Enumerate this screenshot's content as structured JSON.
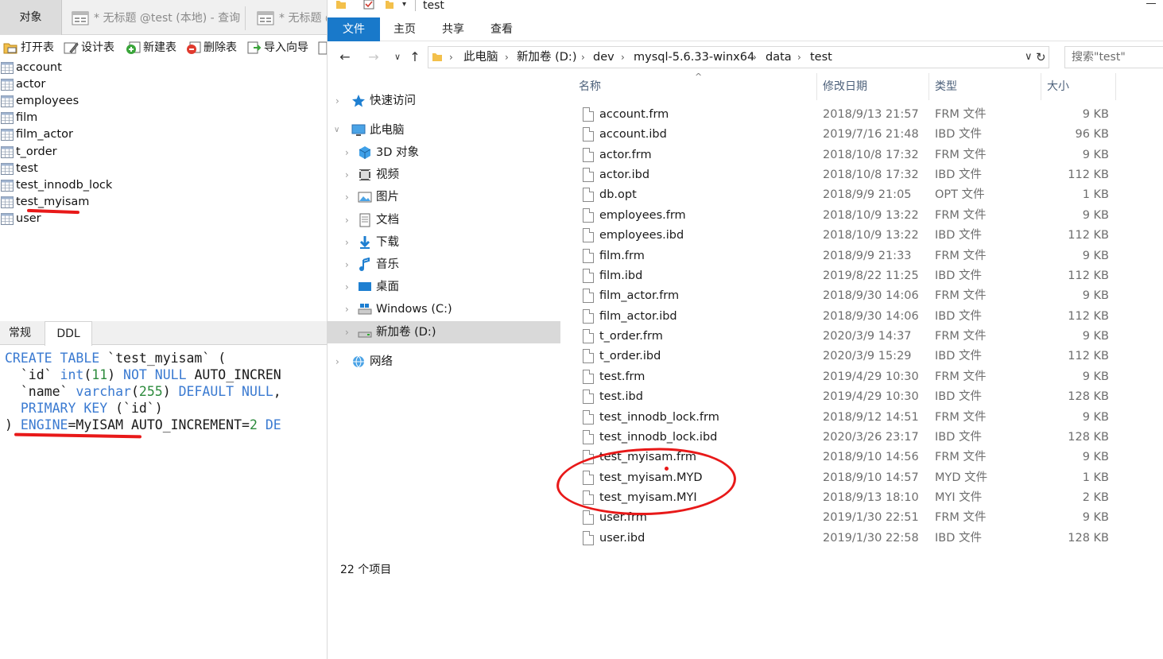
{
  "navicat": {
    "object_tab": "对象",
    "query_tabs": [
      {
        "label": "* 无标题 @test (本地) - 查询"
      },
      {
        "label": "* 无标题 @"
      }
    ],
    "toolbar": [
      {
        "label": "打开表",
        "icon": "open-table-icon"
      },
      {
        "label": "设计表",
        "icon": "design-table-icon"
      },
      {
        "label": "新建表",
        "icon": "new-table-icon"
      },
      {
        "label": "删除表",
        "icon": "delete-table-icon"
      },
      {
        "label": "导入向导",
        "icon": "import-wizard-icon"
      }
    ],
    "tables": [
      "account",
      "actor",
      "employees",
      "film",
      "film_actor",
      "t_order",
      "test",
      "test_innodb_lock",
      "test_myisam",
      "user"
    ],
    "bottom_tabs": [
      "常规",
      "DDL"
    ],
    "ddl": {
      "line1": {
        "create": "CREATE",
        "table": "TABLE",
        "name": " `test_myisam` ("
      },
      "line2": {
        "col": "  `id` ",
        "type": "int",
        "len_open": "(",
        "len": "11",
        "len_close": ") ",
        "notnull": "NOT NULL",
        "rest": " AUTO_INCREN"
      },
      "line3": {
        "col": "  `name` ",
        "type": "varchar",
        "len_open": "(",
        "len": "255",
        "len_close": ") ",
        "def": "DEFAULT NULL",
        "rest": ","
      },
      "line4": {
        "pk": "  PRIMARY KEY",
        "rest": " (`id`)"
      },
      "line5": {
        "close": ") ",
        "engine": "ENGINE",
        "rest": "=MyISAM AUTO_INCREMENT=",
        "num": "2",
        "tail": " DE"
      }
    },
    "colors": {
      "keyword": "#3a7ad1",
      "number": "#2c8a3c",
      "annotation": "#e81919"
    }
  },
  "explorer": {
    "title": "test",
    "ribbon_tabs": [
      "文件",
      "主页",
      "共享",
      "查看"
    ],
    "breadcrumb": [
      "此电脑",
      "新加卷 (D:)",
      "dev",
      "mysql-5.6.33-winx64",
      "data",
      "test"
    ],
    "search_placeholder": "搜索\"test\"",
    "nav": {
      "quick_access": "快速访问",
      "this_pc": "此电脑",
      "children": [
        {
          "label": "3D 对象",
          "icon": "cube-icon"
        },
        {
          "label": "视频",
          "icon": "video-icon"
        },
        {
          "label": "图片",
          "icon": "pictures-icon"
        },
        {
          "label": "文档",
          "icon": "documents-icon"
        },
        {
          "label": "下载",
          "icon": "download-icon"
        },
        {
          "label": "音乐",
          "icon": "music-icon"
        },
        {
          "label": "桌面",
          "icon": "desktop-icon"
        },
        {
          "label": "Windows (C:)",
          "icon": "drive-c-icon"
        },
        {
          "label": "新加卷 (D:)",
          "icon": "drive-d-icon"
        }
      ],
      "network": "网络"
    },
    "columns": {
      "name": "名称",
      "date": "修改日期",
      "type": "类型",
      "size": "大小"
    },
    "files": [
      {
        "name": "account.frm",
        "date": "2018/9/13 21:57",
        "type": "FRM 文件",
        "size": "9 KB"
      },
      {
        "name": "account.ibd",
        "date": "2019/7/16 21:48",
        "type": "IBD 文件",
        "size": "96 KB"
      },
      {
        "name": "actor.frm",
        "date": "2018/10/8 17:32",
        "type": "FRM 文件",
        "size": "9 KB"
      },
      {
        "name": "actor.ibd",
        "date": "2018/10/8 17:32",
        "type": "IBD 文件",
        "size": "112 KB"
      },
      {
        "name": "db.opt",
        "date": "2018/9/9 21:05",
        "type": "OPT 文件",
        "size": "1 KB"
      },
      {
        "name": "employees.frm",
        "date": "2018/10/9 13:22",
        "type": "FRM 文件",
        "size": "9 KB"
      },
      {
        "name": "employees.ibd",
        "date": "2018/10/9 13:22",
        "type": "IBD 文件",
        "size": "112 KB"
      },
      {
        "name": "film.frm",
        "date": "2018/9/9 21:33",
        "type": "FRM 文件",
        "size": "9 KB"
      },
      {
        "name": "film.ibd",
        "date": "2019/8/22 11:25",
        "type": "IBD 文件",
        "size": "112 KB"
      },
      {
        "name": "film_actor.frm",
        "date": "2018/9/30 14:06",
        "type": "FRM 文件",
        "size": "9 KB"
      },
      {
        "name": "film_actor.ibd",
        "date": "2018/9/30 14:06",
        "type": "IBD 文件",
        "size": "112 KB"
      },
      {
        "name": "t_order.frm",
        "date": "2020/3/9 14:37",
        "type": "FRM 文件",
        "size": "9 KB"
      },
      {
        "name": "t_order.ibd",
        "date": "2020/3/9 15:29",
        "type": "IBD 文件",
        "size": "112 KB"
      },
      {
        "name": "test.frm",
        "date": "2019/4/29 10:30",
        "type": "FRM 文件",
        "size": "9 KB"
      },
      {
        "name": "test.ibd",
        "date": "2019/4/29 10:30",
        "type": "IBD 文件",
        "size": "128 KB"
      },
      {
        "name": "test_innodb_lock.frm",
        "date": "2018/9/12 14:51",
        "type": "FRM 文件",
        "size": "9 KB"
      },
      {
        "name": "test_innodb_lock.ibd",
        "date": "2020/3/26 23:17",
        "type": "IBD 文件",
        "size": "128 KB"
      },
      {
        "name": "test_myisam.frm",
        "date": "2018/9/10 14:56",
        "type": "FRM 文件",
        "size": "9 KB"
      },
      {
        "name": "test_myisam.MYD",
        "date": "2018/9/10 14:57",
        "type": "MYD 文件",
        "size": "1 KB"
      },
      {
        "name": "test_myisam.MYI",
        "date": "2018/9/13 18:10",
        "type": "MYI 文件",
        "size": "2 KB"
      },
      {
        "name": "user.frm",
        "date": "2019/1/30 22:51",
        "type": "FRM 文件",
        "size": "9 KB"
      },
      {
        "name": "user.ibd",
        "date": "2019/1/30 22:58",
        "type": "IBD 文件",
        "size": "128 KB"
      }
    ],
    "status": "22 个项目",
    "colors": {
      "file_tab": "#1979ca",
      "header_text": "#4c607a",
      "selected_nav": "#d9d9d9"
    }
  }
}
